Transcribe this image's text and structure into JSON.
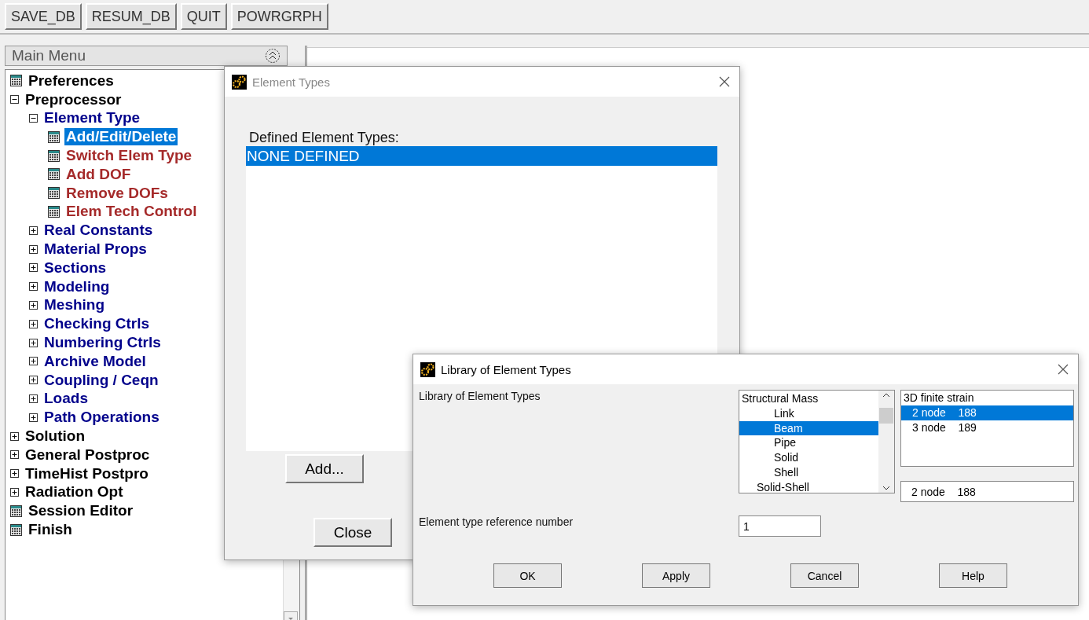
{
  "toolbar": {
    "buttons": [
      "SAVE_DB",
      "RESUM_DB",
      "QUIT",
      "POWRGRPH"
    ]
  },
  "main_menu": {
    "title": "Main Menu",
    "items": [
      {
        "label": "Preferences",
        "kind": "action",
        "selected": false
      },
      {
        "label": "Preprocessor",
        "kind": "folder",
        "expanded": true,
        "selected": false,
        "children": [
          {
            "label": "Element Type",
            "kind": "folder",
            "expanded": true,
            "selected": false,
            "children": [
              {
                "label": "Add/Edit/Delete",
                "kind": "action",
                "selected": true
              },
              {
                "label": "Switch Elem Type",
                "kind": "action",
                "selected": false
              },
              {
                "label": "Add DOF",
                "kind": "action",
                "selected": false
              },
              {
                "label": "Remove DOFs",
                "kind": "action",
                "selected": false
              },
              {
                "label": "Elem Tech Control",
                "kind": "action",
                "selected": false
              }
            ]
          },
          {
            "label": "Real Constants",
            "kind": "folder",
            "expanded": false,
            "selected": false
          },
          {
            "label": "Material Props",
            "kind": "folder",
            "expanded": false,
            "selected": false
          },
          {
            "label": "Sections",
            "kind": "folder",
            "expanded": false,
            "selected": false
          },
          {
            "label": "Modeling",
            "kind": "folder",
            "expanded": false,
            "selected": false
          },
          {
            "label": "Meshing",
            "kind": "folder",
            "expanded": false,
            "selected": false
          },
          {
            "label": "Checking Ctrls",
            "kind": "folder",
            "expanded": false,
            "selected": false
          },
          {
            "label": "Numbering Ctrls",
            "kind": "folder",
            "expanded": false,
            "selected": false
          },
          {
            "label": "Archive Model",
            "kind": "folder",
            "expanded": false,
            "selected": false
          },
          {
            "label": "Coupling / Ceqn",
            "kind": "folder",
            "expanded": false,
            "selected": false
          },
          {
            "label": "Loads",
            "kind": "folder",
            "expanded": false,
            "selected": false
          },
          {
            "label": "Path Operations",
            "kind": "folder",
            "expanded": false,
            "selected": false
          }
        ]
      },
      {
        "label": "Solution",
        "kind": "folder",
        "expanded": false,
        "selected": false
      },
      {
        "label": "General Postproc",
        "kind": "folder",
        "expanded": false,
        "selected": false
      },
      {
        "label": "TimeHist Postpro",
        "kind": "folder",
        "expanded": false,
        "selected": false
      },
      {
        "label": "Radiation Opt",
        "kind": "folder",
        "expanded": false,
        "selected": false
      },
      {
        "label": "Session Editor",
        "kind": "action",
        "selected": false
      },
      {
        "label": "Finish",
        "kind": "action",
        "selected": false
      }
    ]
  },
  "element_types_dialog": {
    "title": "Element Types",
    "list_label": "Defined Element Types:",
    "items": [
      {
        "label": "NONE DEFINED",
        "selected": true
      }
    ],
    "buttons": [
      "Add...",
      "Close"
    ]
  },
  "library_dialog": {
    "title": "Library of Element Types",
    "library_label": "Library of Element Types",
    "categories": [
      {
        "label": "Structural Mass",
        "kind": "group",
        "selected": false
      },
      {
        "label": "Link",
        "kind": "type",
        "selected": false
      },
      {
        "label": "Beam",
        "kind": "type",
        "selected": true
      },
      {
        "label": "Pipe",
        "kind": "type",
        "selected": false
      },
      {
        "label": "Solid",
        "kind": "type",
        "selected": false
      },
      {
        "label": "Shell",
        "kind": "type",
        "selected": false
      },
      {
        "label": "Solid-Shell",
        "kind": "subgroup",
        "selected": false
      }
    ],
    "types": [
      {
        "label": "3D finite strain",
        "kind": "group",
        "selected": false
      },
      {
        "label": "2 node    188",
        "kind": "type",
        "selected": true
      },
      {
        "label": "3 node    189",
        "kind": "type",
        "selected": false
      }
    ],
    "chosen_type": "2 node    188",
    "reference_label": "Element type reference number",
    "reference_value": "1",
    "buttons": [
      "OK",
      "Apply",
      "Cancel",
      "Help"
    ]
  }
}
